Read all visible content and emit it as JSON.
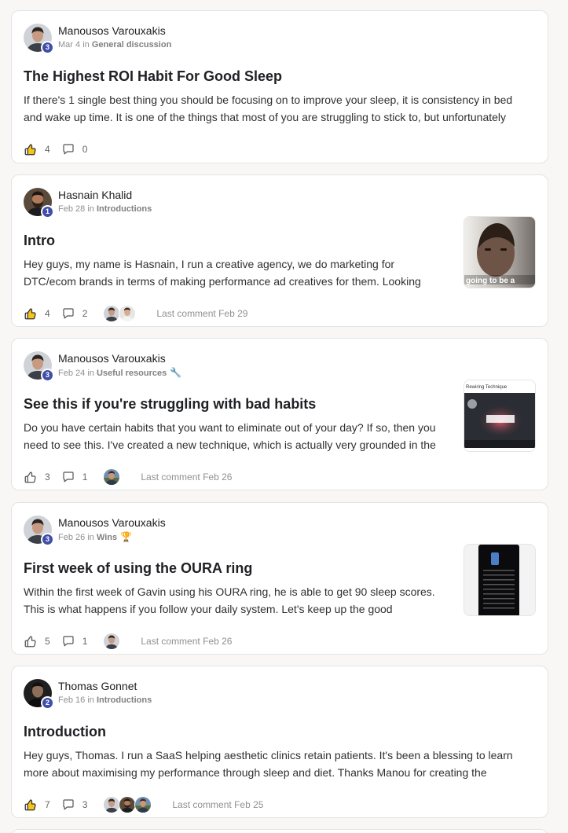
{
  "posts": [
    {
      "author": "Manousos Varouxakis",
      "level": "3",
      "date": "Mar 4",
      "in_label": "in",
      "category": "General discussion",
      "category_emoji": "",
      "title": "The Highest ROI Habit For Good Sleep",
      "body": "If there's 1 single best thing you should be focusing on to improve your sleep, it is consistency in bed and wake up time. It is one of the things that most of you are struggling to stick to, but unfortunately",
      "likes": "4",
      "comments": "0",
      "liked": true,
      "last_comment": ""
    },
    {
      "author": "Hasnain Khalid",
      "level": "1",
      "date": "Feb 28",
      "in_label": "in",
      "category": "Introductions",
      "category_emoji": "",
      "title": "Intro",
      "body": "Hey guys, my name is Hasnain, I run a creative agency, we do marketing for DTC/ecom brands in terms of making performance ad creatives for them. Looking",
      "likes": "4",
      "comments": "2",
      "liked": true,
      "last_comment": "Last comment Feb 29",
      "thumb_caption": "going to be a"
    },
    {
      "author": "Manousos Varouxakis",
      "level": "3",
      "date": "Feb 24",
      "in_label": "in",
      "category": "Useful resources",
      "category_emoji": "🔧",
      "title": "See this if you're struggling with bad habits",
      "body": "Do you have certain habits that you want to eliminate out of your day? If so, then you need to see this. I've created a new technique, which is actually very grounded in the",
      "likes": "3",
      "comments": "1",
      "liked": false,
      "last_comment": "Last comment Feb 26",
      "thumb_caption": "Rewiring Technique"
    },
    {
      "author": "Manousos Varouxakis",
      "level": "3",
      "date": "Feb 26",
      "in_label": "in",
      "category": "Wins",
      "category_emoji": "🏆",
      "title": "First week of using the OURA ring",
      "body": "Within the first week of Gavin using his OURA ring, he is able to get 90 sleep scores. This is what happens if you follow your daily system. Let's keep up the good",
      "likes": "5",
      "comments": "1",
      "liked": false,
      "last_comment": "Last comment Feb 26"
    },
    {
      "author": "Thomas Gonnet",
      "level": "2",
      "date": "Feb 16",
      "in_label": "in",
      "category": "Introductions",
      "category_emoji": "",
      "title": "Introduction",
      "body": "Hey guys, Thomas. I run a SaaS helping aesthetic clinics retain patients. It's been a blessing to learn more about maximising my performance through sleep and diet. Thanks Manou for creating the",
      "likes": "7",
      "comments": "3",
      "liked": true,
      "last_comment": "Last comment Feb 25"
    }
  ],
  "colors": {
    "accent_level_badge": "#3f4ea8",
    "liked_thumb": "#f5c518",
    "page_bg": "#f8f7f5",
    "card_border": "#e4e4e4"
  },
  "icons": {
    "like": "thumbs-up-icon",
    "comment": "comment-bubble-icon"
  }
}
